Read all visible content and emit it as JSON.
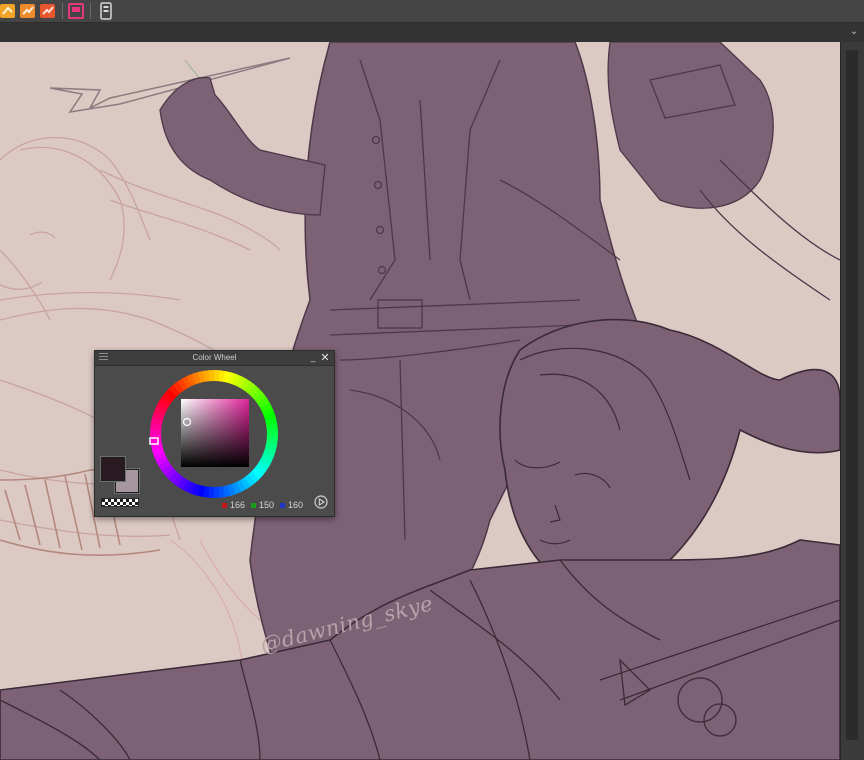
{
  "app": {
    "toolbar": {
      "buttons": [
        {
          "name": "layer-tool-icon",
          "color": "#f2a428"
        },
        {
          "name": "edit-tool-icon",
          "color": "#ef8b2c"
        },
        {
          "name": "clip-tool-icon",
          "color": "#e8562e"
        },
        {
          "name": "flag-tool-icon",
          "color": "#e6367e"
        },
        {
          "name": "device-icon",
          "color": "#d8d8d8"
        }
      ]
    },
    "subbar": {
      "expand_icon": "chevron-down-icon",
      "expand_glyph": "⌄"
    }
  },
  "canvas": {
    "watermark": "@dawning_skye",
    "background_color": "#dcc9c4",
    "figure_color": "#7d6275"
  },
  "color_wheel_panel": {
    "title": "Color Wheel",
    "minimize_glyph": "_",
    "close_glyph": "✕",
    "foreground_color": "#2a1a21",
    "background_color": "#a6969f",
    "rgb": {
      "r": "166",
      "g": "150",
      "b": "160"
    },
    "rgb_colors": {
      "r": "#c21818",
      "g": "#1a9c1a",
      "b": "#1f35c8"
    },
    "hue_color": "#e0259b"
  }
}
